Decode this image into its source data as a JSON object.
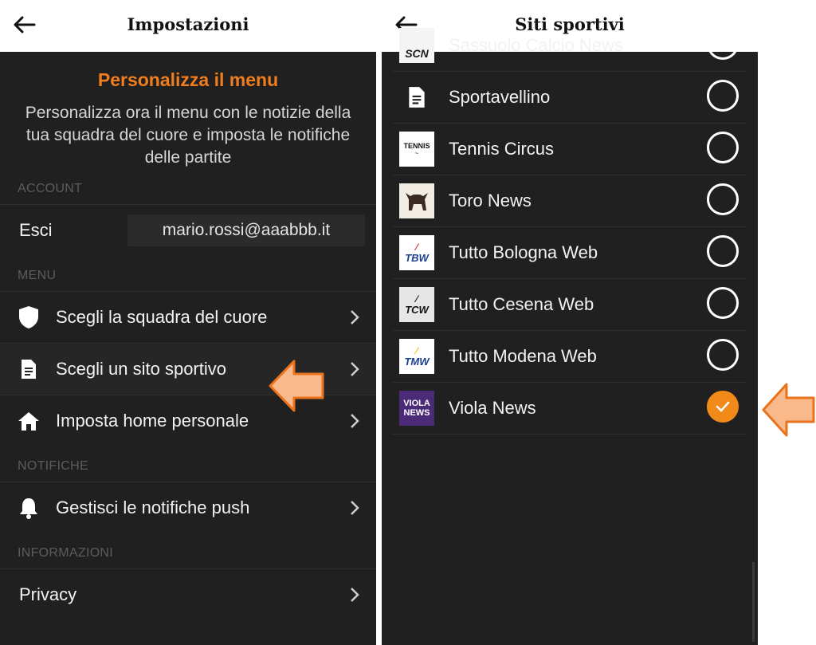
{
  "left": {
    "header_title": "Impostazioni",
    "promo": {
      "title": "Personalizza il menu",
      "text": "Personalizza ora il menu con le notizie della tua squadra del cuore e imposta le notifiche delle partite"
    },
    "sections": {
      "account": "ACCOUNT",
      "menu": "MENU",
      "notifiche": "NOTIFICHE",
      "informazioni": "INFORMAZIONI"
    },
    "account": {
      "esci_label": "Esci",
      "email": "mario.rossi@aaabbb.it"
    },
    "menu_items": [
      {
        "label": "Scegli la squadra del cuore",
        "icon": "shield-icon"
      },
      {
        "label": "Scegli un sito sportivo",
        "icon": "document-icon"
      },
      {
        "label": "Imposta home personale",
        "icon": "home-icon"
      }
    ],
    "notifiche_items": [
      {
        "label": "Gestisci le notifiche push",
        "icon": "bell-icon"
      }
    ],
    "info_items": [
      {
        "label": "Privacy"
      }
    ]
  },
  "right": {
    "header_title": "Siti sportivi",
    "sites": [
      {
        "name": "Sassuolo Calcio News",
        "logo_text": "SCN",
        "selected": false
      },
      {
        "name": "Sportavellino",
        "logo_text": "",
        "selected": false
      },
      {
        "name": "Tennis Circus",
        "logo_text": "TENNIS",
        "selected": false
      },
      {
        "name": "Toro News",
        "logo_text": "",
        "selected": false
      },
      {
        "name": "Tutto Bologna Web",
        "logo_text": "TBW",
        "selected": false
      },
      {
        "name": "Tutto Cesena Web",
        "logo_text": "TCW",
        "selected": false
      },
      {
        "name": "Tutto Modena Web",
        "logo_text": "TMW",
        "selected": false
      },
      {
        "name": "Viola News",
        "logo_text": "VIOLA",
        "selected": true
      }
    ]
  },
  "colors": {
    "accent": "#f07d1e",
    "dark_bg": "#202020",
    "arrow_fill": "#f9b98a",
    "arrow_stroke": "#e8731c"
  }
}
